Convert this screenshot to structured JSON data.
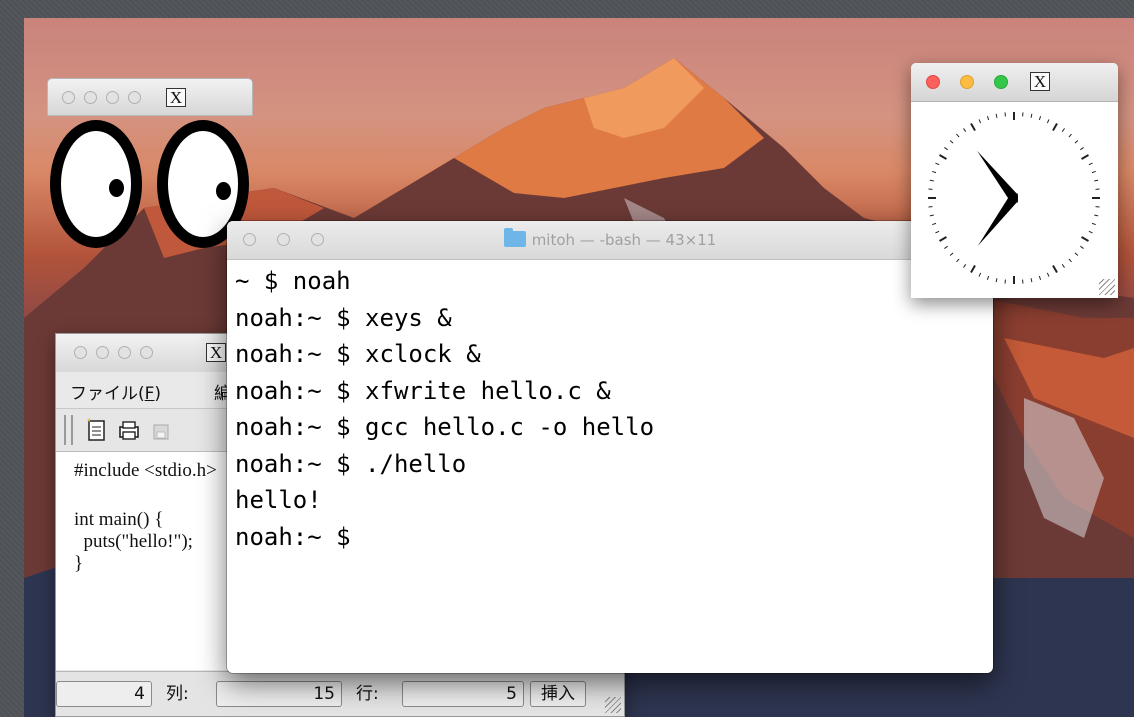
{
  "xeyes": {
    "title_icon": "x-logo-icon",
    "title_x": "X"
  },
  "xclock": {
    "title_icon": "x-logo-icon",
    "title_x": "X",
    "hour_hand": "analog-clock"
  },
  "editor": {
    "title_x": "X",
    "menu": {
      "file": "ファイル(",
      "file_key": "F",
      "file_close": ")",
      "edit_partial": "編"
    },
    "code_lines": [
      "#include <stdio.h>",
      "",
      "int main() {",
      "  puts(\"hello!\");",
      "}"
    ],
    "status": {
      "line_value": "4",
      "col_label": "列:",
      "col_value": "15",
      "row_label": "行:",
      "row_value": "5",
      "mode": "挿入"
    }
  },
  "terminal": {
    "title": "mitoh — -bash — 43×11",
    "lines": [
      "~ $ noah",
      "noah:~ $ xeys &",
      "noah:~ $ xclock &",
      "noah:~ $ xfwrite hello.c &",
      "noah:~ $ gcc hello.c -o hello",
      "noah:~ $ ./hello",
      "hello!",
      "noah:~ $"
    ]
  },
  "colors": {
    "close": "#fc605c",
    "minimize": "#fdbc40",
    "zoom": "#34c84a",
    "folder": "#6fb6e8"
  }
}
